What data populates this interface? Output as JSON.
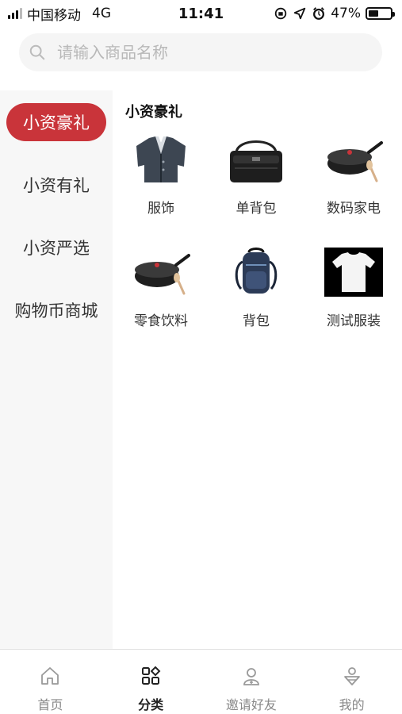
{
  "status_bar": {
    "carrier": "中国移动",
    "network": "4G",
    "time": "11:41",
    "battery": "47%",
    "battery_level": 0.47
  },
  "search": {
    "placeholder": "请输入商品名称"
  },
  "sidebar": {
    "items": [
      {
        "label": "小资豪礼",
        "active": true
      },
      {
        "label": "小资有礼",
        "active": false
      },
      {
        "label": "小资严选",
        "active": false
      },
      {
        "label": "购物币商城",
        "active": false
      }
    ]
  },
  "content": {
    "section_title": "小资豪礼",
    "categories": [
      {
        "label": "服饰",
        "icon": "jacket-icon"
      },
      {
        "label": "单背包",
        "icon": "handbag-icon"
      },
      {
        "label": "数码家电",
        "icon": "pan-icon"
      },
      {
        "label": "零食饮料",
        "icon": "pan-icon"
      },
      {
        "label": "背包",
        "icon": "backpack-icon"
      },
      {
        "label": "测试服装",
        "icon": "tshirt-icon"
      }
    ]
  },
  "tab_bar": {
    "tabs": [
      {
        "label": "首页",
        "icon": "home-icon",
        "active": false
      },
      {
        "label": "分类",
        "icon": "category-icon",
        "active": true
      },
      {
        "label": "邀请好友",
        "icon": "invite-icon",
        "active": false
      },
      {
        "label": "我的",
        "icon": "profile-icon",
        "active": false
      }
    ]
  },
  "colors": {
    "accent": "#c9343a",
    "sidebar_bg": "#f7f7f7"
  }
}
